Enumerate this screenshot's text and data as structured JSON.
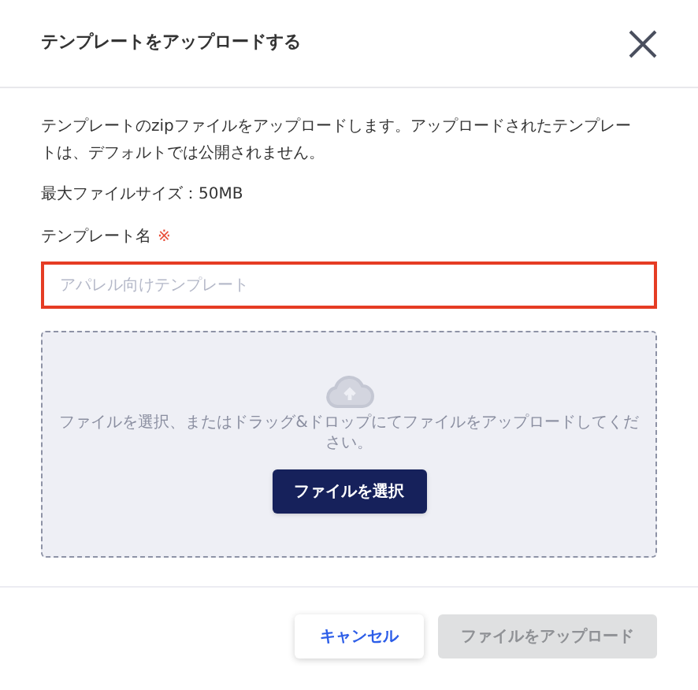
{
  "dialog": {
    "title": "テンプレートをアップロードする"
  },
  "description": "テンプレートのzipファイルをアップロードします。アップロードされたテンプレートは、デフォルトでは公開されません。",
  "max_size": "最大ファイルサイズ：50MB",
  "name_field": {
    "label": "テンプレート名",
    "required_mark": "※",
    "placeholder": "アパレル向けテンプレート",
    "error": true
  },
  "dropzone": {
    "hint": "ファイルを選択、またはドラッグ&ドロップにてファイルをアップロードしてください。",
    "button": "ファイルを選択"
  },
  "footer": {
    "buttons": [
      {
        "label": "キャンセル",
        "kind": "secondary",
        "disabled": false
      },
      {
        "label": "ファイルをアップロード",
        "kind": "primary",
        "disabled": true
      }
    ]
  }
}
